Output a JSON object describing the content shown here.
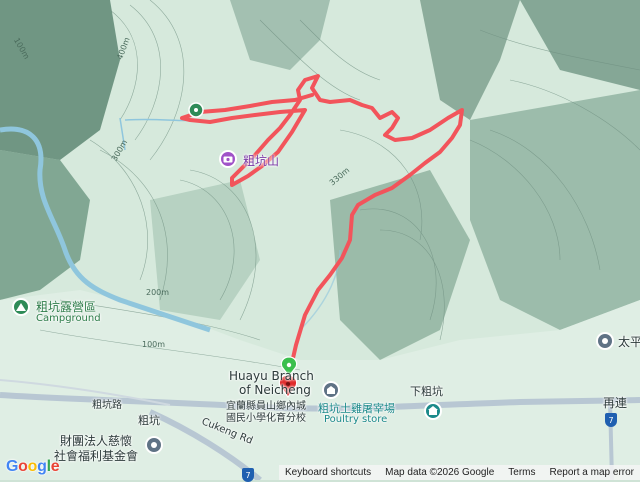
{
  "map": {
    "contours": [
      "400m",
      "300m",
      "330m",
      "200m",
      "100m"
    ],
    "places": {
      "peak": "粗坑山",
      "campground_zh": "粗坑露營區",
      "campground_en": "Campground",
      "school_line1": "Huayu Branch",
      "school_line2": "of Neicheng",
      "school_zh1": "宜蘭縣員山鄉內城",
      "school_zh2": "國民小學化育分校",
      "xia_cukeng": "下粗坑",
      "cukeng_road_zh": "粗坑路",
      "cukeng": "粗坑",
      "cukeng_road_en": "Cukeng Rd",
      "foundation_zh1": "財團法人慈懷",
      "foundation_zh2": "社會福利基金會",
      "poultry_zh": "粗坑土雞屠宰場",
      "poultry_en": "Poultry store",
      "right_town": "太平",
      "zailian": "再連",
      "road_shield": "7"
    }
  },
  "footer": {
    "logo": "Google",
    "keyboard": "Keyboard shortcuts",
    "map_data": "Map data ©2026 Google",
    "terms": "Terms",
    "report": "Report a map error"
  },
  "colors": {
    "track": "#f2545b",
    "water": "#8fc6dd",
    "road": "#b8c7d3"
  }
}
